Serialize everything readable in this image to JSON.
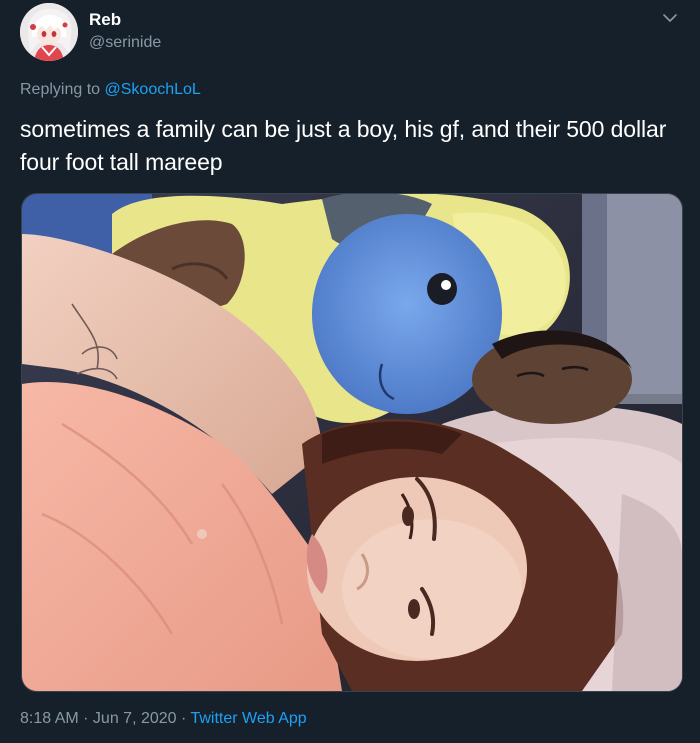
{
  "author": {
    "display_name": "Reb",
    "handle": "@serinide"
  },
  "reply": {
    "prefix": "Replying to ",
    "mention": "@SkoochLoL"
  },
  "tweet": {
    "text": "sometimes a family can be just a boy, his gf, and their 500 dollar four foot tall mareep"
  },
  "meta": {
    "time": "8:18 AM",
    "separator1": " · ",
    "date": "Jun 7, 2020",
    "separator2": " · ",
    "source": "Twitter Web App"
  },
  "icons": {
    "menu": "chevron-down-icon"
  },
  "colors": {
    "background": "#15202b",
    "secondary_text": "#8899a6",
    "link": "#1da1f2"
  }
}
